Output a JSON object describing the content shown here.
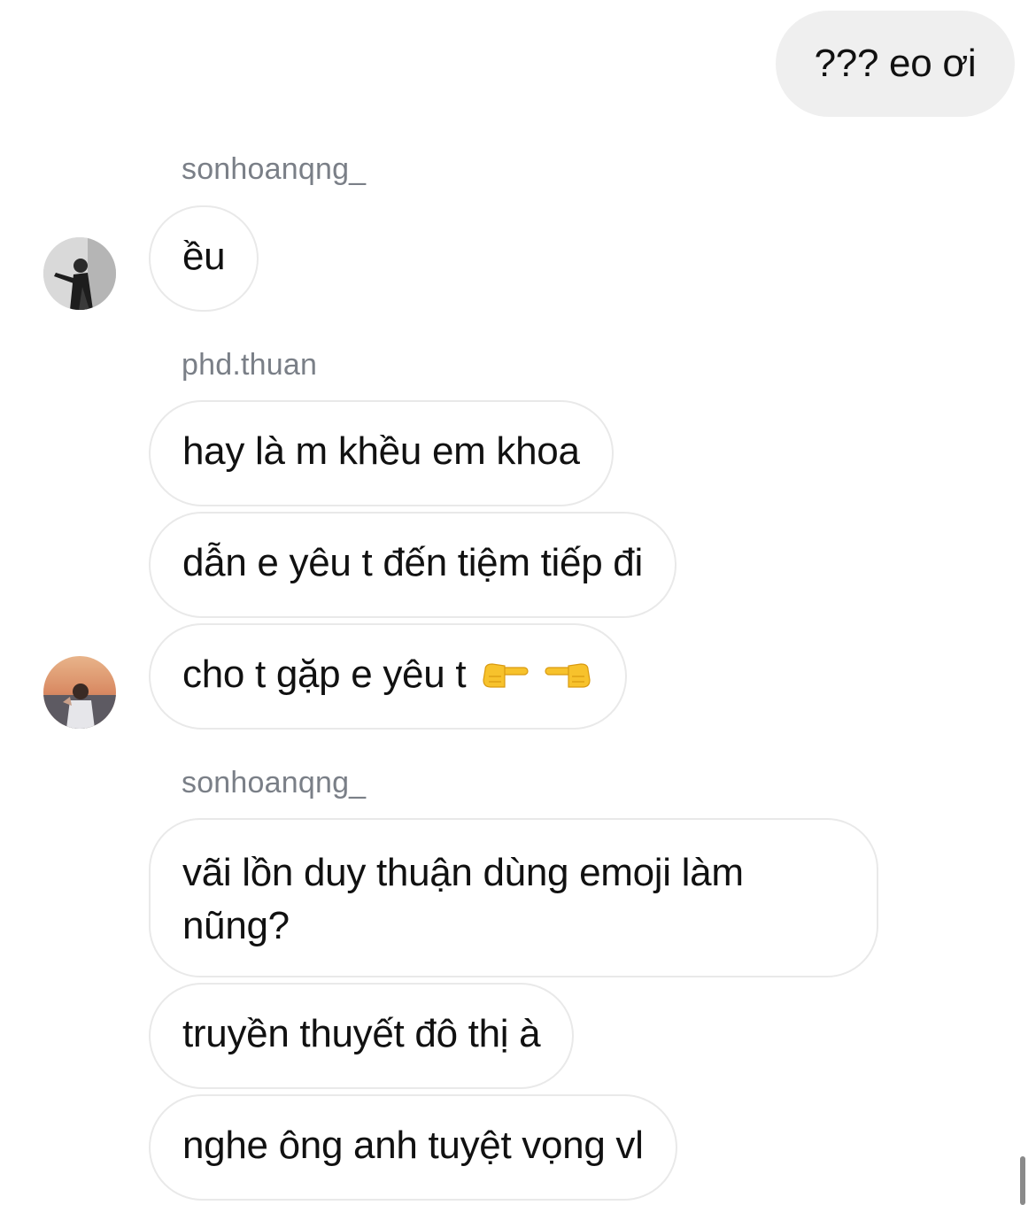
{
  "messages": {
    "outgoing_1": "??? eo ơi",
    "group_1": {
      "sender": "sonhoanqng_",
      "m1": "ều"
    },
    "group_2": {
      "sender": "phd.thuan",
      "m1": "hay là m khều em khoa",
      "m2": "dẫn e yêu t đến tiệm tiếp đi",
      "m3": "cho t gặp e yêu t"
    },
    "group_3": {
      "sender": "sonhoanqng_",
      "m1": "vãi lồn duy thuận dùng emoji làm nũng?",
      "m2": "truyền thuyết đô thị à",
      "m3": "nghe ông anh tuyệt vọng vl"
    }
  },
  "icons": {
    "pointing_right": "pointing-right-emoji",
    "pointing_left": "pointing-left-emoji"
  },
  "colors": {
    "outgoing_bubble": "#efefef",
    "incoming_border": "#e9e9e9",
    "sender_name": "#7a7f87",
    "emoji_yellow": "#f7c22c"
  }
}
